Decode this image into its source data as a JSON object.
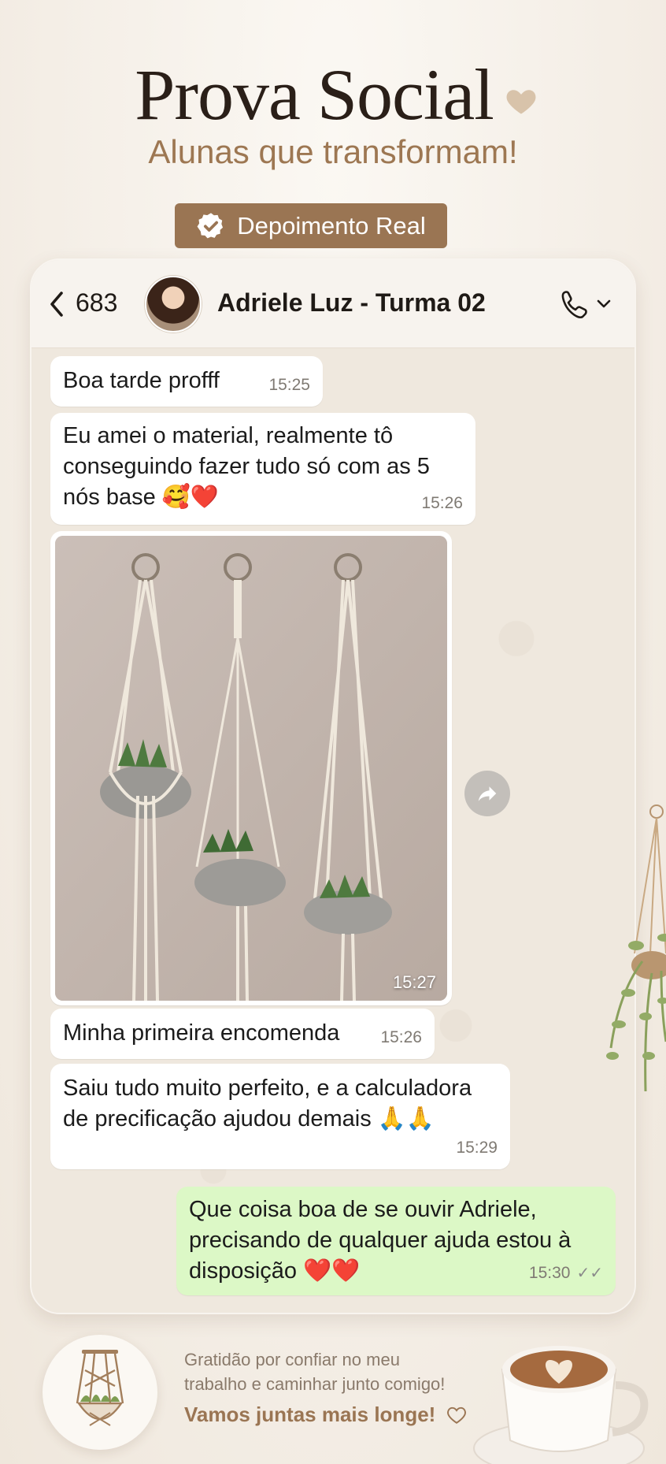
{
  "header": {
    "title": "Prova Social",
    "subtitle": "Alunas que transformam!",
    "badge": "Depoimento Real"
  },
  "chat": {
    "back_count": "683",
    "contact_name": "Adriele Luz - Turma 02",
    "messages": [
      {
        "text": "Boa tarde profff",
        "time": "15:25",
        "from": "contact"
      },
      {
        "text": "Eu amei o material, realmente tô\nconseguindo fazer tudo só com as 5\nnós base 🥰❤️",
        "time": "15:26",
        "from": "contact"
      },
      {
        "image": "macrame-plant-hangers-photo",
        "time": "15:27",
        "from": "contact"
      },
      {
        "text": "Minha primeira encomenda",
        "time": "15:26",
        "from": "contact"
      },
      {
        "text": "Saiu tudo muito perfeito, e a calculadora\nde precificação ajudou demais 🙏🙏",
        "time": "15:29",
        "from": "contact"
      },
      {
        "text": "Que coisa boa de se ouvir Adriele,\nprecisando de qualquer ajuda estou à\ndisposição ❤️❤️",
        "time": "15:30",
        "from": "me",
        "status": "read"
      }
    ]
  },
  "footer": {
    "line1": "Gratidão por confiar no meu",
    "line2": "trabalho e caminhar junto comigo!",
    "cta": "Vamos juntas mais longe!"
  },
  "colors": {
    "accent": "#9a7553",
    "bubble_me": "#dcf8c6",
    "background": "#f6f1ea"
  }
}
